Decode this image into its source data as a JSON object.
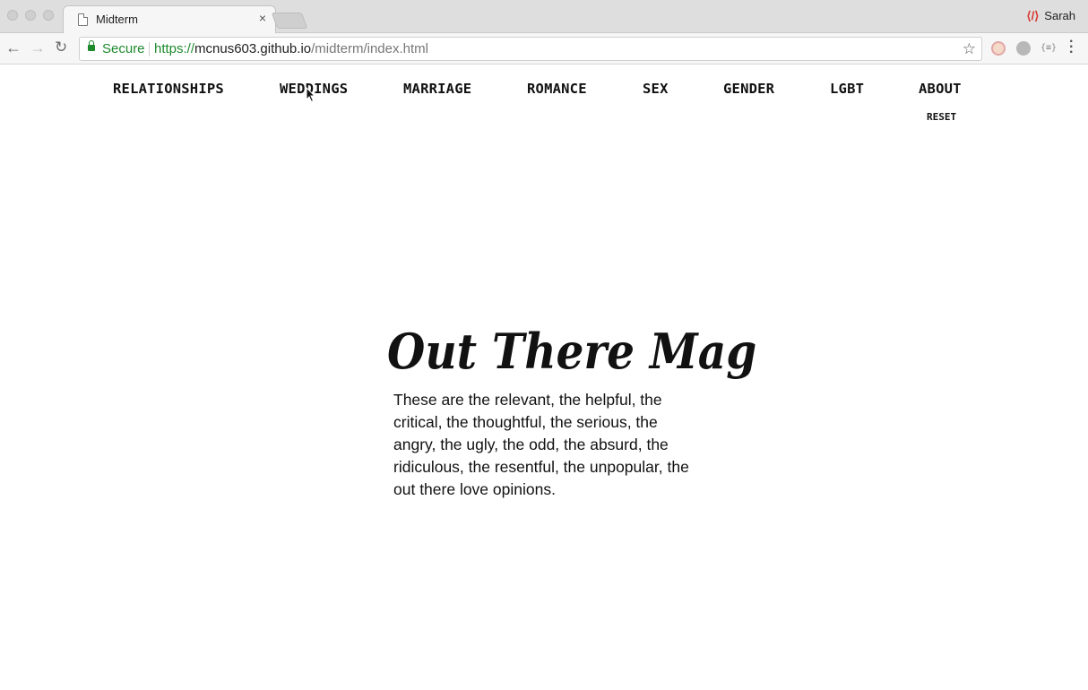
{
  "browser": {
    "tab_title": "Midterm",
    "tab_close": "×",
    "profile_name": "Sarah",
    "secure_label": "Secure",
    "url_scheme": "https://",
    "url_host": "mcnus603.github.io",
    "url_path": "/midterm/index.html"
  },
  "icons": {
    "back": "arrow-left-icon",
    "forward": "arrow-right-icon",
    "reload": "reload-icon",
    "lock": "lock-icon",
    "bookmark": "star-icon",
    "menu": "more-vert-icon"
  },
  "colors": {
    "secure_green": "#1e8a2e",
    "text": "#111111",
    "background": "#ffffff"
  },
  "site": {
    "nav": [
      "RELATIONSHIPS",
      "WEDDINGS",
      "MARRIAGE",
      "ROMANCE",
      "SEX",
      "GENDER",
      "LGBT",
      "ABOUT"
    ],
    "reset_label": "RESET",
    "masthead": "Out There Mag",
    "blurb": "These are the relevant, the helpful, the critical, the thoughtful, the serious, the angry, the ugly, the odd, the absurd, the ridiculous, the resentful, the unpopular, the out there love opinions."
  }
}
